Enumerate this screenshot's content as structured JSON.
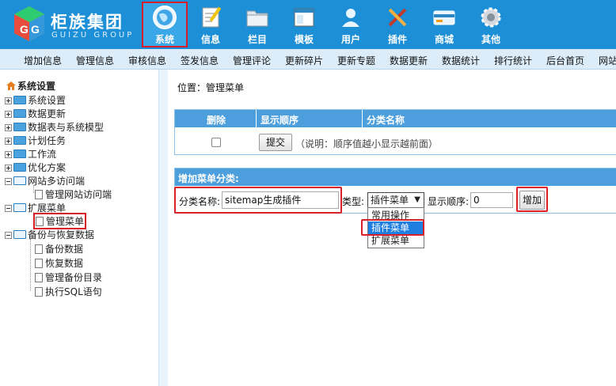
{
  "logo": {
    "name": "柜族集团",
    "sub": "GUIZU GROUP"
  },
  "nav": [
    {
      "label": "系统",
      "icon": "globe-icon",
      "active": true
    },
    {
      "label": "信息",
      "icon": "notepad-icon"
    },
    {
      "label": "栏目",
      "icon": "folder-icon"
    },
    {
      "label": "模板",
      "icon": "window-icon"
    },
    {
      "label": "用户",
      "icon": "user-icon"
    },
    {
      "label": "插件",
      "icon": "tools-icon"
    },
    {
      "label": "商城",
      "icon": "card-icon"
    },
    {
      "label": "其他",
      "icon": "gear-icon"
    }
  ],
  "subnav": [
    "增加信息",
    "管理信息",
    "审核信息",
    "签发信息",
    "管理评论",
    "更新碎片",
    "更新专题",
    "数据更新",
    "数据统计",
    "排行统计",
    "后台首页",
    "网站"
  ],
  "sidebar": {
    "root": "系统设置",
    "items": [
      {
        "label": "系统设置"
      },
      {
        "label": "数据更新"
      },
      {
        "label": "数据表与系统模型"
      },
      {
        "label": "计划任务"
      },
      {
        "label": "工作流"
      },
      {
        "label": "优化方案"
      },
      {
        "label": "网站多访问端"
      },
      {
        "label": "管理网站访问端"
      },
      {
        "label": "扩展菜单"
      },
      {
        "label": "管理菜单"
      },
      {
        "label": "备份与恢复数据"
      },
      {
        "label": "备份数据"
      },
      {
        "label": "恢复数据"
      },
      {
        "label": "管理备份目录"
      },
      {
        "label": "执行SQL语句"
      }
    ]
  },
  "breadcrumb": {
    "prefix": "位置：",
    "current": "管理菜单"
  },
  "list_table": {
    "headers": [
      "删除",
      "显示顺序",
      "分类名称"
    ],
    "submit_label": "提交",
    "note": "（说明：顺序值越小显示越前面）"
  },
  "add_form": {
    "title": "增加菜单分类:",
    "name_label": "分类名称:",
    "name_value": "sitemap生成插件",
    "type_label": "类型:",
    "type_value": "插件菜单",
    "type_options": [
      "常用操作",
      "插件菜单",
      "扩展菜单"
    ],
    "order_label": "显示顺序:",
    "order_value": "0",
    "add_label": "增加"
  },
  "colors": {
    "header": "#1d8fd6",
    "table_header": "#4c9fdc",
    "highlight": "#d9202a"
  }
}
